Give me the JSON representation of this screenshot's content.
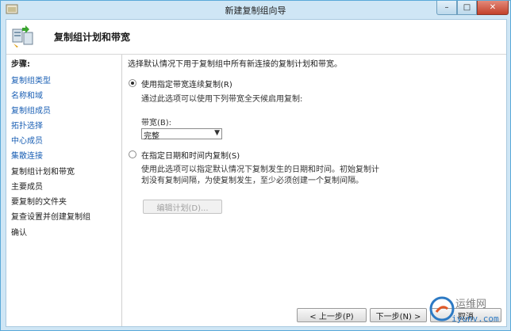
{
  "window": {
    "title": "新建复制组向导",
    "controls": {
      "minimize": "–",
      "maximize": "□",
      "close": "✕"
    }
  },
  "header": {
    "title": "复制组计划和带宽",
    "icon": "wizard-icon"
  },
  "sidebar": {
    "label": "步骤:",
    "steps": [
      {
        "label": "复制组类型",
        "state": "link"
      },
      {
        "label": "名称和域",
        "state": "link"
      },
      {
        "label": "复制组成员",
        "state": "link"
      },
      {
        "label": "拓扑选择",
        "state": "link"
      },
      {
        "label": "中心成员",
        "state": "link"
      },
      {
        "label": "集散连接",
        "state": "link"
      },
      {
        "label": "复制组计划和带宽",
        "state": "current"
      },
      {
        "label": "主要成员",
        "state": "pending"
      },
      {
        "label": "要复制的文件夹",
        "state": "pending"
      },
      {
        "label": "复查设置并创建复制组",
        "state": "pending"
      },
      {
        "label": "确认",
        "state": "pending"
      }
    ]
  },
  "main": {
    "intro": "选择默认情况下用于复制组中所有新连接的复制计划和带宽。",
    "option1": {
      "label": "使用指定带宽连续复制(R)",
      "selected": true,
      "desc": "通过此选项可以使用下列带宽全天候启用复制:",
      "bandwidth_label": "带宽(B):",
      "bandwidth_value": "完整"
    },
    "option2": {
      "label": "在指定日期和时间内复制(S)",
      "selected": false,
      "desc_line1": "使用此选项可以指定默认情况下复制发生的日期和时间。初始复制计",
      "desc_line2": "划没有复制间隔，为使复制发生，至少必须创建一个复制间隔。",
      "edit_button": "编辑计划(D)..."
    }
  },
  "footer": {
    "back": "< 上一步(P)",
    "next": "下一步(N) >",
    "cancel": "取消"
  },
  "watermark": {
    "text": "运维网",
    "url": "iyunv.com"
  }
}
